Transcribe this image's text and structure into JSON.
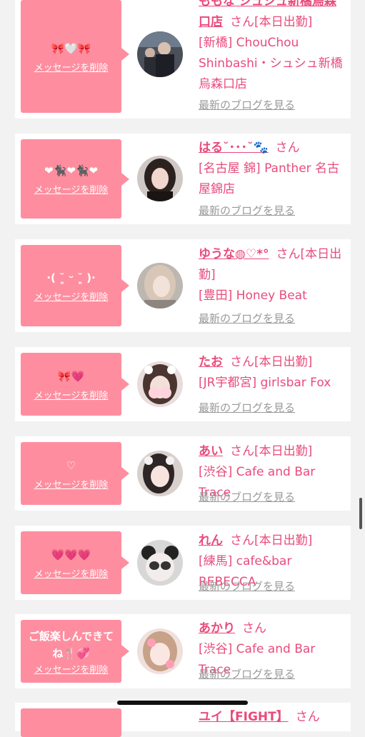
{
  "colors": {
    "accent": "#e94b7c",
    "message_box": "#fe8e9f",
    "muted": "#999999"
  },
  "delete_label": "メッセージを削除",
  "blog_label": "最新のブログを見る",
  "san": "さん",
  "cards": [
    {
      "message": "🎀🤍🎀",
      "name": "ももな シュシュ新橋烏森口店",
      "status": "[本日出勤]",
      "shop": "[新橋] ChouChou Shinbashi・シュシュ新橋烏森口店",
      "avatar_icon": "avatar-photo-icon"
    },
    {
      "message": "❤︎🐈‍⬛❤︎🐈‍⬛❤︎",
      "name": "はる˘･･･˘🐾",
      "status": "",
      "shop": "[名古屋 錦] Panther 名古屋錦店",
      "avatar_icon": "avatar-photo-icon"
    },
    {
      "message": "·( ˘͈ ᵕ ˘͈ )·",
      "name": "ゆうな◍♡*°",
      "status": "[本日出勤]",
      "shop": "[豊田] Honey Beat",
      "avatar_icon": "avatar-photo-icon"
    },
    {
      "message": "🎀💗",
      "name": "たお",
      "status": "[本日出勤]",
      "shop": "[JR宇都宮] girlsbar Fox",
      "avatar_icon": "avatar-photo-icon"
    },
    {
      "message": "♡",
      "name": "あい",
      "status": "[本日出勤]",
      "shop": "[渋谷] Cafe and Bar Trace",
      "avatar_icon": "avatar-photo-icon"
    },
    {
      "message": "💗💗💗",
      "name": "れん",
      "status": "[本日出勤]",
      "shop": "[練馬] cafe&bar REBECCA",
      "avatar_icon": "avatar-photo-icon"
    },
    {
      "message": "ご飯楽しんできてね🍴💞",
      "name": "あかり",
      "status": "",
      "shop": "[渋谷] Cafe and Bar Trace",
      "avatar_icon": "avatar-photo-icon"
    },
    {
      "message": "",
      "name": "ユイ【FIGHT】",
      "status": "",
      "shop": "",
      "avatar_icon": "avatar-photo-icon"
    }
  ]
}
